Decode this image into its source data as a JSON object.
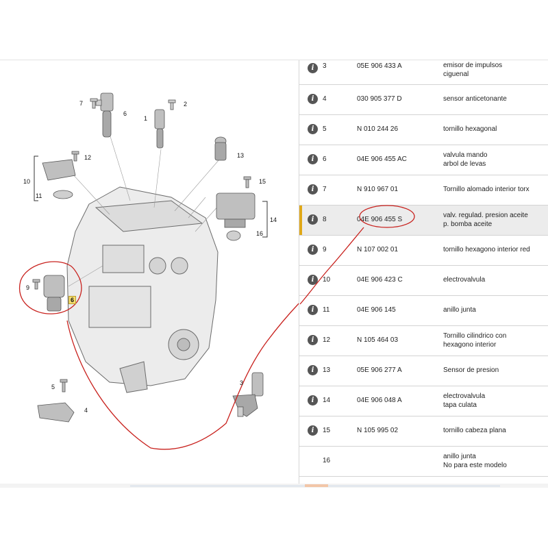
{
  "diagram": {
    "callouts": [
      "7",
      "6",
      "1",
      "2",
      "12",
      "13",
      "10",
      "11",
      "15",
      "14",
      "16",
      "9",
      "6",
      "5",
      "4",
      "3"
    ]
  },
  "parts": [
    {
      "pos": "3",
      "number": "05E 906 433 A",
      "desc": [
        "emisor de impulsos",
        "ciguenal"
      ]
    },
    {
      "pos": "4",
      "number": "030 905 377 D",
      "desc": [
        "sensor anticetonante"
      ]
    },
    {
      "pos": "5",
      "number": "N   010 244 26",
      "desc": [
        "tornillo hexagonal"
      ]
    },
    {
      "pos": "6",
      "number": "04E 906 455 AC",
      "desc": [
        "valvula mando",
        "arbol de levas"
      ]
    },
    {
      "pos": "7",
      "number": "N   910 967 01",
      "desc": [
        "Tornillo alomado interior torx"
      ]
    },
    {
      "pos": "8",
      "number": "04E 906 455 S",
      "desc": [
        "valv. regulad. presion aceite",
        "p. bomba aceite"
      ]
    },
    {
      "pos": "9",
      "number": "N   107 002 01",
      "desc": [
        "tornillo hexagono interior red"
      ]
    },
    {
      "pos": "10",
      "number": "04E 906 423 C",
      "desc": [
        "electrovalvula"
      ]
    },
    {
      "pos": "11",
      "number": "04E 906 145",
      "desc": [
        "anillo junta"
      ]
    },
    {
      "pos": "12",
      "number": "N   105 464 03",
      "desc": [
        "Tornillo cilindrico con",
        "hexagono interior"
      ]
    },
    {
      "pos": "13",
      "number": "05E 906 277 A",
      "desc": [
        "Sensor de presion"
      ]
    },
    {
      "pos": "14",
      "number": "04E 906 048 A",
      "desc": [
        "electrovalvula",
        "tapa culata"
      ]
    },
    {
      "pos": "15",
      "number": "N   105 995 02",
      "desc": [
        "tornillo cabeza plana"
      ]
    },
    {
      "pos": "16",
      "number": "",
      "desc": [
        "anillo junta",
        "No para este modelo"
      ]
    }
  ],
  "selected_pos": "8",
  "colors": {
    "highlight": "#e0a818",
    "annotation": "#c8201c",
    "info_icon": "#555555",
    "selected_row": "#ececec"
  }
}
